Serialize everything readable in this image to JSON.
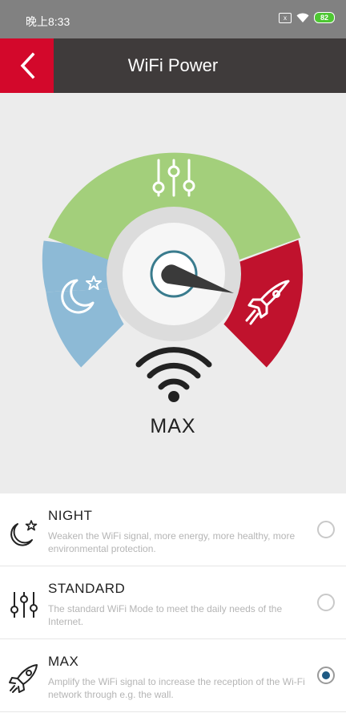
{
  "status_bar": {
    "time": "晚上8:33",
    "sim_label": "x",
    "battery": "82"
  },
  "header": {
    "title": "WiFi Power"
  },
  "gauge": {
    "current_mode": "MAX",
    "colors": {
      "night": "#8dbad6",
      "standard": "#a3cf7b",
      "max": "#c0122d"
    }
  },
  "options": [
    {
      "title": "NIGHT",
      "description": "Weaken the WiFi signal, more energy, more healthy, more environmental protection.",
      "icon": "moon-stars-icon",
      "selected": false
    },
    {
      "title": "STANDARD",
      "description": "The standard WiFi Mode to meet the daily needs of the Internet.",
      "icon": "sliders-icon",
      "selected": false
    },
    {
      "title": "MAX",
      "description": "Amplify the WiFi signal to increase the reception of the Wi-Fi network through e.g. the wall.",
      "icon": "rocket-icon",
      "selected": true
    }
  ]
}
